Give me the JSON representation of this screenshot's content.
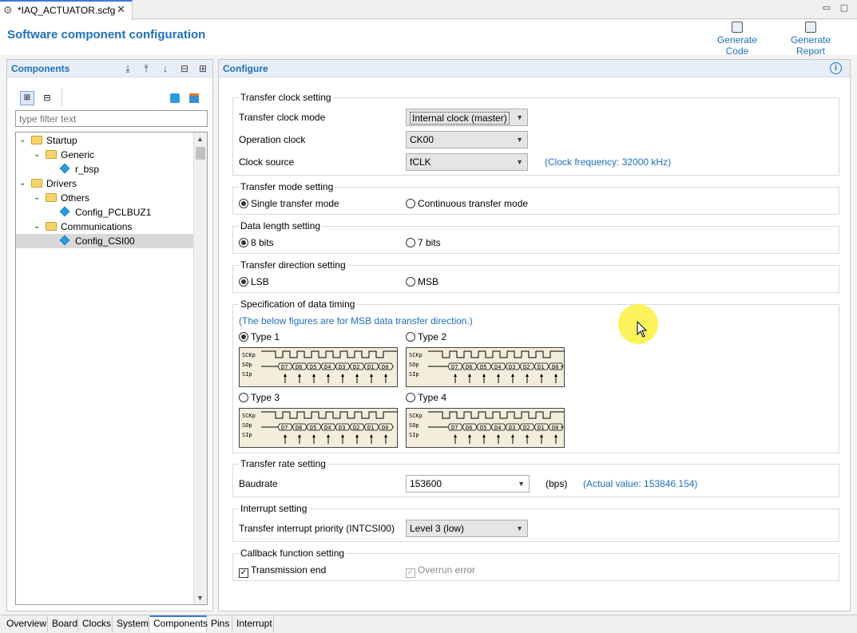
{
  "window": {
    "tab_title": "*IAQ_ACTUATOR.scfg",
    "close_glyph": "✕",
    "min_glyph": "▭",
    "max_glyph": "▢"
  },
  "header": {
    "title": "Software component configuration",
    "generate_code": "Generate Code",
    "generate_report": "Generate Report"
  },
  "components": {
    "title": "Components",
    "filter_placeholder": "type filter text",
    "tree": [
      {
        "label": "Startup",
        "level": 0,
        "type": "folder",
        "expanded": true
      },
      {
        "label": "Generic",
        "level": 1,
        "type": "folder",
        "expanded": true
      },
      {
        "label": "r_bsp",
        "level": 2,
        "type": "component"
      },
      {
        "label": "Drivers",
        "level": 0,
        "type": "folder",
        "expanded": true
      },
      {
        "label": "Others",
        "level": 1,
        "type": "folder",
        "expanded": true
      },
      {
        "label": "Config_PCLBUZ1",
        "level": 2,
        "type": "component"
      },
      {
        "label": "Communications",
        "level": 1,
        "type": "folder",
        "expanded": true
      },
      {
        "label": "Config_CSI00",
        "level": 2,
        "type": "component",
        "selected": true
      }
    ]
  },
  "configure": {
    "title": "Configure",
    "info_icon": "i",
    "transfer_clock": {
      "title": "Transfer clock setting",
      "mode_label": "Transfer clock mode",
      "mode_value": "Internal clock (master)",
      "op_label": "Operation clock",
      "op_value": "CK00",
      "src_label": "Clock source",
      "src_value": "fCLK",
      "freq_note": "(Clock frequency: 32000 kHz)"
    },
    "transfer_mode": {
      "title": "Transfer mode setting",
      "opt1": "Single transfer mode",
      "opt2": "Continuous transfer mode",
      "selected": 1
    },
    "data_length": {
      "title": "Data length setting",
      "opt1": "8 bits",
      "opt2": "7 bits",
      "selected": 1
    },
    "direction": {
      "title": "Transfer direction setting",
      "opt1": "LSB",
      "opt2": "MSB",
      "selected": 1
    },
    "timing": {
      "title": "Specification of data timing",
      "note": "(The below figures are for MSB data transfer direction.)",
      "types": [
        "Type 1",
        "Type 2",
        "Type 3",
        "Type 4"
      ],
      "selected": 1,
      "signals": [
        "SCKp",
        "SOp",
        "SIp"
      ],
      "bits": [
        "D7",
        "D6",
        "D5",
        "D4",
        "D3",
        "D2",
        "D1",
        "D0"
      ]
    },
    "rate": {
      "title": "Transfer rate setting",
      "label": "Baudrate",
      "value": "153600",
      "unit": "(bps)",
      "actual": "(Actual value: 153846.154)"
    },
    "interrupt": {
      "title": "Interrupt setting",
      "label": "Transfer interrupt priority (INTCSI00)",
      "value": "Level 3 (low)"
    },
    "callback": {
      "title": "Callback function setting",
      "opt1": "Transmission end",
      "opt2": "Overrun error",
      "opt1_checked": true,
      "opt2_checked": true,
      "opt2_disabled": true
    }
  },
  "bottom_tabs": [
    "Overview",
    "Board",
    "Clocks",
    "System",
    "Components",
    "Pins",
    "Interrupt"
  ],
  "active_tab": "Components",
  "colors": {
    "accent": "#1e6fc0",
    "cursor_highlight": "#fbf25c"
  }
}
